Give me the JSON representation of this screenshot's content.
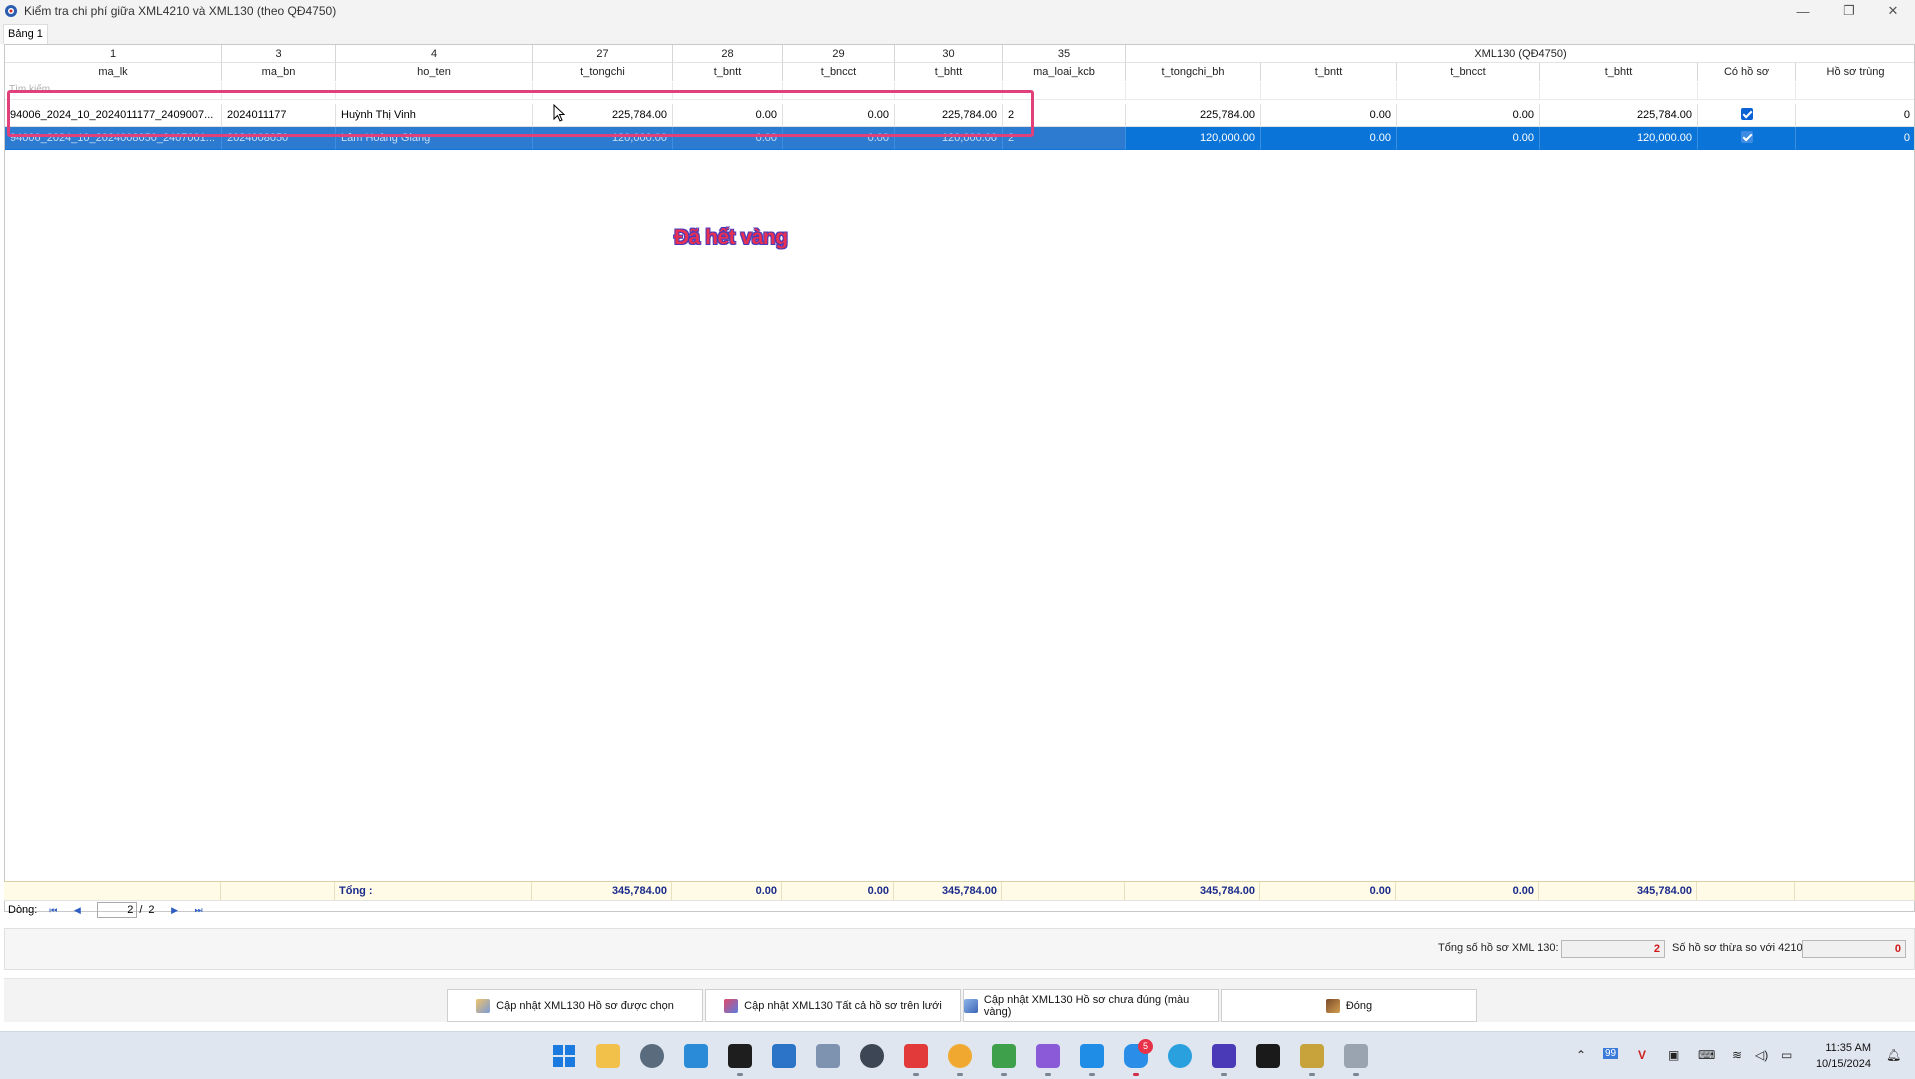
{
  "window": {
    "title": "Kiểm tra chi phí giữa XML4210 và XML130 (theo QĐ4750)",
    "minimize": "—",
    "maximize": "❐",
    "close": "✕"
  },
  "tab": {
    "label": "Bảng 1"
  },
  "header_numbers": [
    "1",
    "3",
    "4",
    "27",
    "28",
    "29",
    "30",
    "35"
  ],
  "header_group": "XML130 (QĐ4750)",
  "columns": [
    "ma_lk",
    "ma_bn",
    "ho_ten",
    "t_tongchi",
    "t_bntt",
    "t_bncct",
    "t_bhtt",
    "ma_loai_kcb",
    "t_tongchi_bh",
    "t_bntt",
    "t_bncct",
    "t_bhtt",
    "Có hồ sơ",
    "Hồ sơ trùng"
  ],
  "filter_placeholder": "Tìm kiếm",
  "rows": [
    {
      "ma_lk": "94006_2024_10_2024011177_2409007...",
      "ma_bn": "2024011177",
      "ho_ten": "Huỳnh Thị Vinh",
      "t_tongchi": "225,784.00",
      "t_bntt": "0.00",
      "t_bncct": "0.00",
      "t_bhtt": "225,784.00",
      "ma_loai_kcb": "2",
      "t_tongchi_bh": "225,784.00",
      "t_bntt_130": "0.00",
      "t_bncct_130": "0.00",
      "t_bhtt_130": "225,784.00",
      "co_ho_so": true,
      "ho_so_trung": "0"
    },
    {
      "ma_lk": "94006_2024_10_2024008050_2407001...",
      "ma_bn": "2024008050",
      "ho_ten": "Lâm Hoàng Giang",
      "t_tongchi": "120,000.00",
      "t_bntt": "0.00",
      "t_bncct": "0.00",
      "t_bhtt": "120,000.00",
      "ma_loai_kcb": "2",
      "t_tongchi_bh": "120,000.00",
      "t_bntt_130": "0.00",
      "t_bncct_130": "0.00",
      "t_bhtt_130": "120,000.00",
      "co_ho_so": true,
      "ho_so_trung": "0"
    }
  ],
  "watermark": "Đã hết vàng",
  "totals": {
    "label": "Tổng :",
    "t_tongchi": "345,784.00",
    "t_bntt": "0.00",
    "t_bncct": "0.00",
    "t_bhtt": "345,784.00",
    "t_tongchi_bh": "345,784.00",
    "t_bntt_130": "0.00",
    "t_bncct_130": "0.00",
    "t_bhtt_130": "345,784.00"
  },
  "pager": {
    "label": "Dòng:",
    "current": "2",
    "separator": "/",
    "total": "2"
  },
  "summary": {
    "total_label": "Tổng số hồ sơ XML 130:",
    "total_value": "2",
    "excess_label": "Số hồ sơ thừa so với 4210:",
    "excess_value": "0"
  },
  "buttons": {
    "update_selected": "Cập nhật XML130 Hồ sơ được chọn",
    "update_all": "Cập nhật XML130 Tất cả hồ sơ trên lưới",
    "update_wrong": "Cập nhật XML130 Hồ sơ chưa đúng (màu vàng)",
    "close": "Đóng"
  },
  "taskbar": {
    "badge_count": "5",
    "tray_ime": "99",
    "time": "11:35 AM",
    "date": "10/15/2024"
  },
  "colors": {
    "selection": "#0a74d8",
    "highlight_box": "#e0417a",
    "totals_text": "#1a2b8c",
    "summary_value": "#d01818"
  }
}
